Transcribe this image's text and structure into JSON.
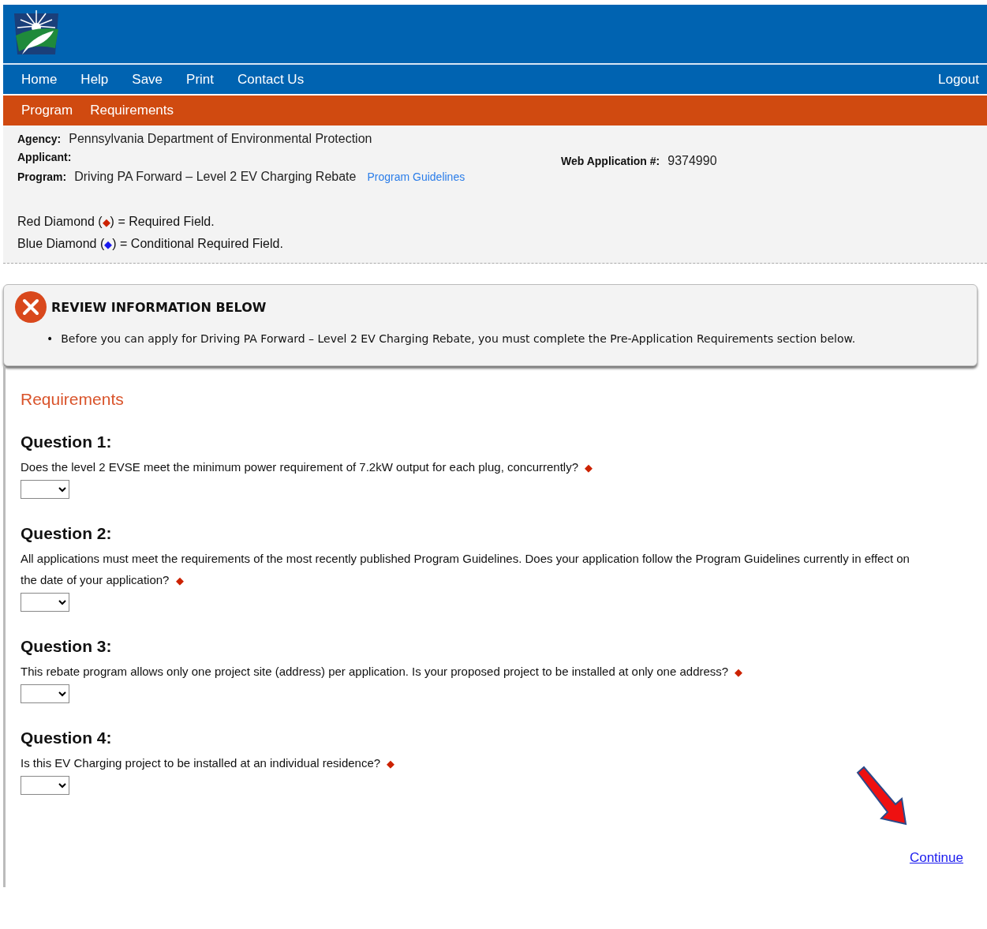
{
  "nav": {
    "items": [
      "Home",
      "Help",
      "Save",
      "Print",
      "Contact Us"
    ],
    "logout": "Logout"
  },
  "subnav": {
    "items": [
      "Program",
      "Requirements"
    ]
  },
  "info": {
    "agency_label": "Agency:",
    "agency": "Pennsylvania Department of Environmental Protection",
    "applicant_label": "Applicant:",
    "program_label": "Program:",
    "program": "Driving PA Forward – Level 2 EV Charging Rebate",
    "guidelines_link": "Program Guidelines",
    "web_app_label": "Web Application #:",
    "web_app_number": "9374990"
  },
  "legend": [
    {
      "prefix": "Red Diamond (",
      "diamond": "◆",
      "suffix": ") = Required Field.",
      "color": "#cc2200"
    },
    {
      "prefix": "Blue Diamond (",
      "diamond": "◆",
      "suffix": ") = Conditional Required Field.",
      "color": "#1a1aee"
    }
  ],
  "alert": {
    "title": "REVIEW INFORMATION BELOW",
    "bullet": "•",
    "messages": [
      "Before you can apply for Driving PA Forward – Level 2 EV Charging Rebate, you must complete the Pre-Application Requirements section below."
    ]
  },
  "section_title": "Requirements",
  "questions": [
    {
      "title": "Question 1:",
      "text": "Does the level 2 EVSE meet the minimum power requirement of 7.2kW output for each plug, concurrently?",
      "diamond": "◆"
    },
    {
      "title": "Question 2:",
      "text": "All applications must meet the requirements of the most recently published Program Guidelines. Does your application follow the Program Guidelines currently in effect on the date of your application?",
      "diamond": "◆"
    },
    {
      "title": "Question 3:",
      "text": "This rebate program allows only one project site (address) per application. Is your proposed project to be installed at only one address?",
      "diamond": "◆"
    },
    {
      "title": "Question 4:",
      "text": "Is this EV Charging project to be installed at an individual residence?",
      "diamond": "◆"
    }
  ],
  "continue_link": "Continue"
}
